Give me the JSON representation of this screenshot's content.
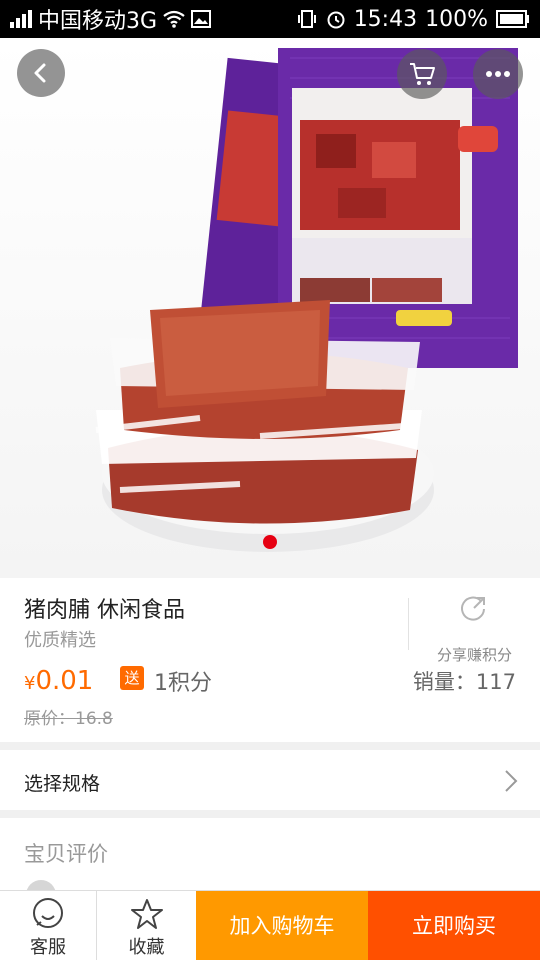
{
  "status_bar": {
    "carrier": "中国移动3G",
    "time": "15:43",
    "battery": "100%",
    "icons": [
      "signal-icon",
      "wifi-icon",
      "image-icon",
      "vibrate-icon",
      "alarm-icon",
      "battery-icon"
    ]
  },
  "product": {
    "title": "猪肉脯 休闲食品",
    "subtitle": "优质精选",
    "currency": "¥",
    "price": "0.01",
    "gift_badge": "送",
    "points": "1积分",
    "sales": "销量：117",
    "original_price": "原价：16.8",
    "share_label": "分享赚积分",
    "image_carousel": {
      "total_slides": 1,
      "active_slide": 1,
      "dot_color": "#e60012"
    }
  },
  "spec": {
    "label": "选择规格"
  },
  "reviews": {
    "label": "宝贝评价"
  },
  "bottom_bar": {
    "service_label": "客服",
    "favorite_label": "收藏",
    "add_to_cart_label": "加入购物车",
    "buy_now_label": "立即购买"
  },
  "colors": {
    "accent_price": "#ff6a00",
    "add_to_cart_bg": "#ff9900",
    "buy_now_bg": "#ff5000",
    "package_purple": "#6a2aa8"
  }
}
